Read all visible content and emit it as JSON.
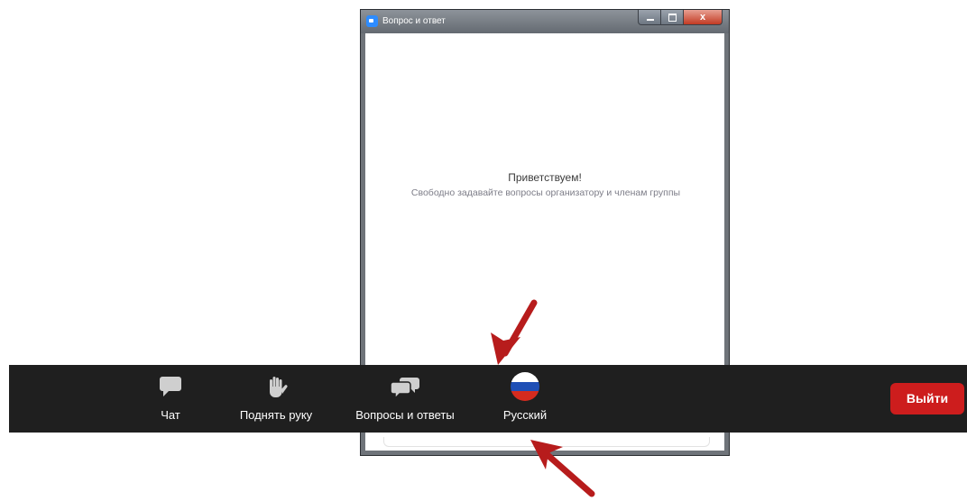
{
  "window": {
    "title": "Вопрос и ответ",
    "close_symbol": "x"
  },
  "qa": {
    "welcome_title": "Приветствуем!",
    "welcome_text": "Свободно задавайте вопросы организатору и членам группы"
  },
  "toolbar": {
    "items": [
      {
        "label": "Чат",
        "icon": "chat-bubble-icon"
      },
      {
        "label": "Поднять руку",
        "icon": "raise-hand-icon"
      },
      {
        "label": "Вопросы и ответы",
        "icon": "qa-bubbles-icon"
      },
      {
        "label": "Русский",
        "icon": "russian-flag-icon"
      }
    ],
    "leave_label": "Выйти"
  },
  "colors": {
    "toolbar_bg": "#1f1f1f",
    "leave_button": "#cd1d1d",
    "icon_gray": "#cfcfcf",
    "arrow": "#b71c1c",
    "flag_white": "#ffffff",
    "flag_blue": "#1f4fb5",
    "flag_red": "#d52b1e"
  }
}
